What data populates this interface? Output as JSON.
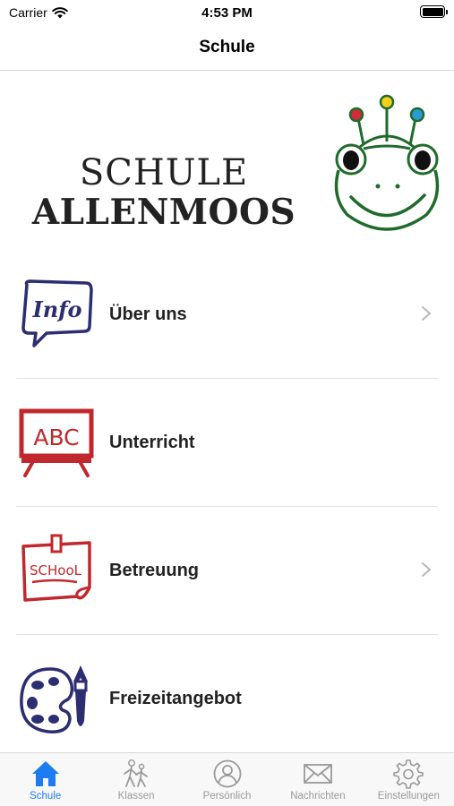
{
  "status_bar": {
    "carrier": "Carrier",
    "time": "4:53 PM"
  },
  "nav": {
    "title": "Schule"
  },
  "logo": {
    "line1": "SCHULE",
    "line2": "ALLENMOOS"
  },
  "menu": [
    {
      "label": "Über uns",
      "icon": "info-speech-bubble-icon",
      "has_chevron": true
    },
    {
      "label": "Unterricht",
      "icon": "abc-chalkboard-icon",
      "has_chevron": false
    },
    {
      "label": "Betreuung",
      "icon": "school-note-icon",
      "has_chevron": true
    },
    {
      "label": "Freizeitangebot",
      "icon": "paint-palette-icon",
      "has_chevron": false
    }
  ],
  "icon_text": {
    "info": "Info",
    "abc": "ABC",
    "school": "SCHooL"
  },
  "tabs": [
    {
      "label": "Schule",
      "icon": "house-icon",
      "active": true
    },
    {
      "label": "Klassen",
      "icon": "walking-children-icon",
      "active": false
    },
    {
      "label": "Persönlich",
      "icon": "person-icon",
      "active": false
    },
    {
      "label": "Nachrichten",
      "icon": "envelope-icon",
      "active": false
    },
    {
      "label": "Einstellungen",
      "icon": "gear-icon",
      "active": false
    }
  ],
  "colors": {
    "accent": "#1e7cf2",
    "frog_green": "#1e6b2a",
    "red_icon": "#c0282d",
    "navy_icon": "#2d2d72"
  }
}
